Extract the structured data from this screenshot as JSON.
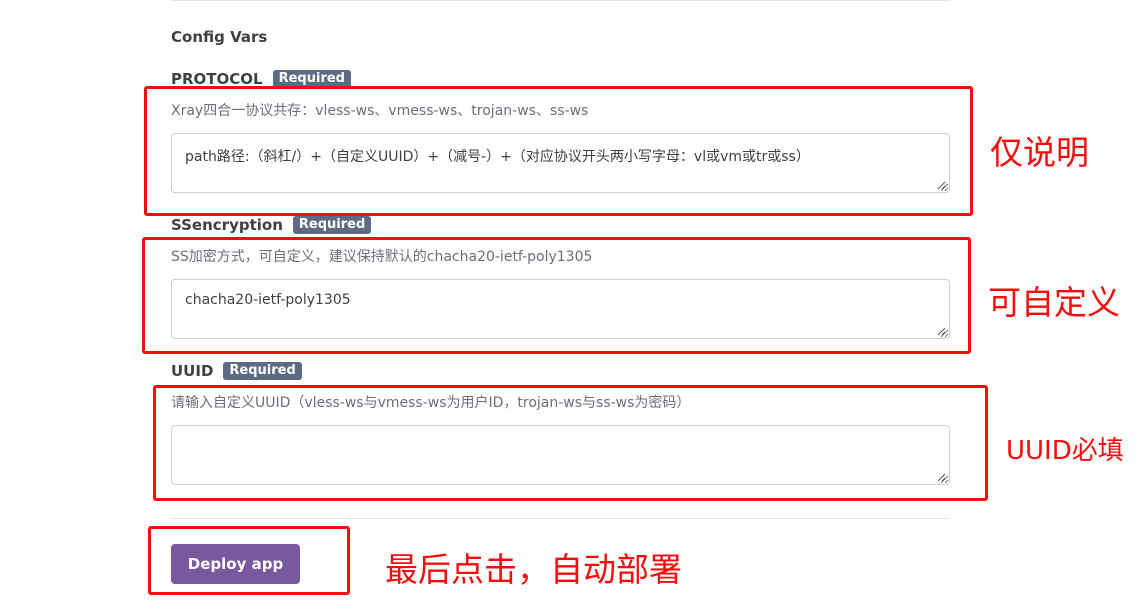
{
  "section_title": "Config Vars",
  "required_badge": "Required",
  "fields": [
    {
      "label": "PROTOCOL",
      "description": "Xray四合一协议共存：vless-ws、vmess-ws、trojan-ws、ss-ws",
      "value": "path路径:（斜杠/）+（自定义UUID）+（减号-）+（对应协议开头两小写字母：vl或vm或tr或ss）"
    },
    {
      "label": "SSencryption",
      "description": "SS加密方式，可自定义，建议保持默认的chacha20-ietf-poly1305",
      "value": "chacha20-ietf-poly1305"
    },
    {
      "label": "UUID",
      "description": "请输入自定义UUID（vless-ws与vmess-ws为用户ID，trojan-ws与ss-ws为密码）",
      "value": ""
    }
  ],
  "deploy_button": "Deploy app",
  "annotations": {
    "protocol": "仅说明",
    "ssencryption": "可自定义",
    "uuid": "UUID必填",
    "deploy": "最后点击，自动部署"
  },
  "colors": {
    "annotation_red": "#f40d0d",
    "button_purple": "#79589f",
    "badge_slate": "#5d6b82"
  }
}
